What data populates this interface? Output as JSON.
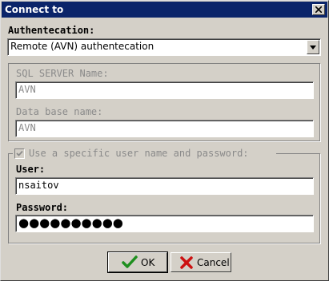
{
  "window": {
    "title": "Connect to"
  },
  "auth": {
    "label": "Authentecation:",
    "selected": "Remote (AVN) authentecation"
  },
  "server_group": {
    "sql_server_label": "SQL SERVER Name:",
    "sql_server_value": "AVN",
    "database_label": "Data base name:",
    "database_value": "AVN"
  },
  "credentials": {
    "checkbox_label": "Use a specific user name and password:",
    "checkbox_checked": true,
    "user_label": "User:",
    "user_value": "nsaitov",
    "password_label": "Password:",
    "password_value": "●●●●●●●●●●"
  },
  "buttons": {
    "ok_label": "OK",
    "cancel_label": "Cancel"
  },
  "colors": {
    "titlebar": "#0a246a",
    "ok_check": "#1f8f1f",
    "cancel_x": "#cc1111"
  }
}
